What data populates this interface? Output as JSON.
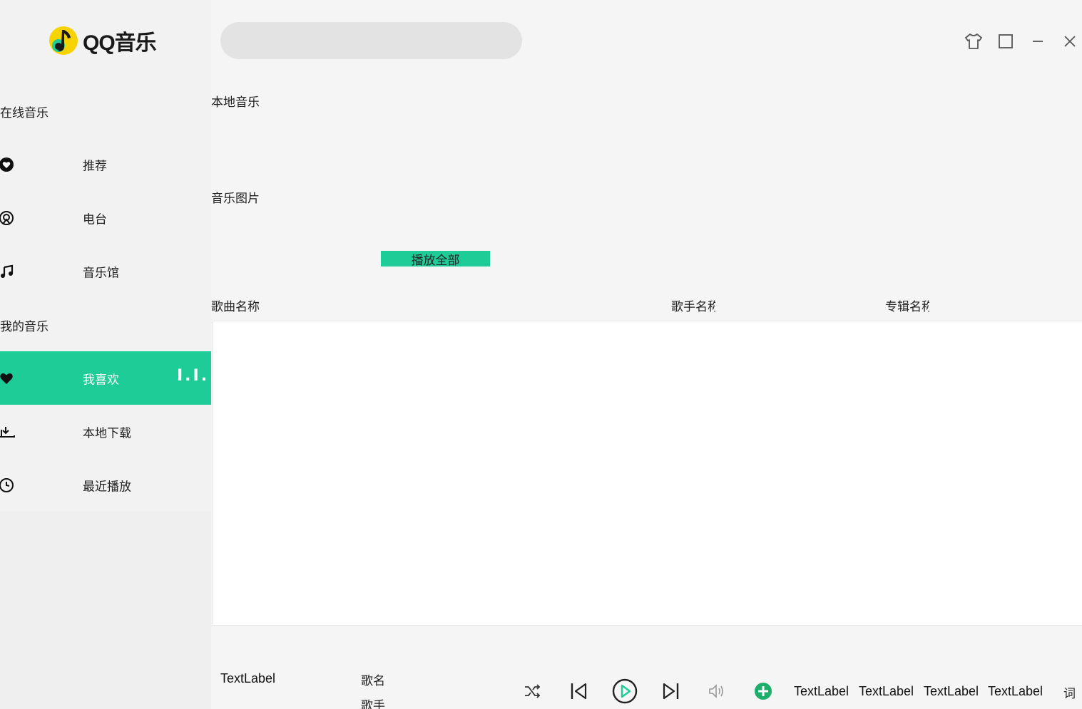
{
  "app": {
    "logo_text": "QQ音乐",
    "accent_color": "#1ecc97"
  },
  "search": {
    "placeholder": "",
    "value": ""
  },
  "window_controls": [
    "skin-icon",
    "maximize-icon",
    "minimize-icon",
    "close-icon"
  ],
  "sidebar": {
    "online_heading": "在线音乐",
    "online_items": [
      {
        "label": "推荐",
        "icon": "heart-circle-icon"
      },
      {
        "label": "电台",
        "icon": "radio-icon"
      },
      {
        "label": "音乐馆",
        "icon": "music-note-icon"
      }
    ],
    "my_heading": "我的音乐",
    "my_items": [
      {
        "label": "我喜欢",
        "icon": "heart-icon",
        "active": true
      },
      {
        "label": "本地下载",
        "icon": "download-icon"
      },
      {
        "label": "最近播放",
        "icon": "clock-icon"
      }
    ],
    "active_indicator": "I.I."
  },
  "main": {
    "page_title": "本地音乐",
    "image_label": "音乐图片",
    "play_all_label": "播放全部",
    "columns": [
      "歌曲名称",
      "歌手名称",
      "专辑名称"
    ]
  },
  "player": {
    "cover_label": "TextLabel",
    "song_name": "歌名",
    "singer": "歌手",
    "controls": [
      "shuffle-icon",
      "previous-icon",
      "play-icon",
      "next-icon",
      "volume-icon",
      "add-icon"
    ],
    "labels": [
      "TextLabel",
      "TextLabel",
      "TextLabel",
      "TextLabel"
    ],
    "lyric_label": "词"
  }
}
